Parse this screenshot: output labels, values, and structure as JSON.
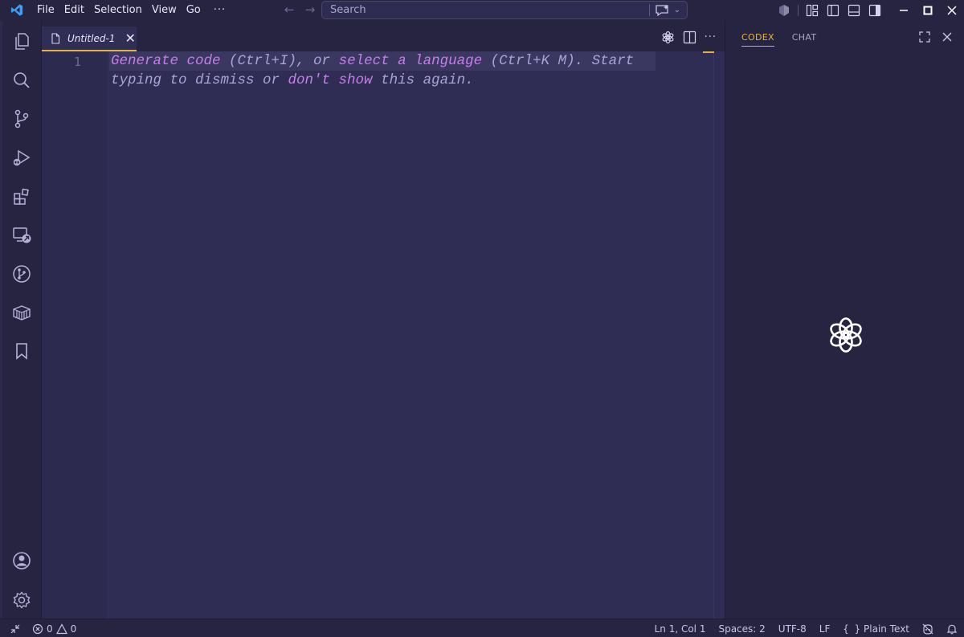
{
  "menu": {
    "items": [
      "File",
      "Edit",
      "Selection",
      "View",
      "Go"
    ],
    "more": "···"
  },
  "search": {
    "placeholder": "Search"
  },
  "tab": {
    "label": "Untitled-1",
    "close": "✕"
  },
  "editor": {
    "line_number": "1",
    "hint": {
      "part1": "Generate code",
      "part2": " (Ctrl+I), or ",
      "part3": "select a language",
      "part4": " (Ctrl+K M). Start",
      "part5": "typing to dismiss or ",
      "part6": "don't show",
      "part7": " this again."
    },
    "more": "···"
  },
  "panel": {
    "tabs": [
      "CODEX",
      "CHAT"
    ],
    "active_tab": "CODEX"
  },
  "status": {
    "errors": "0",
    "warnings": "0",
    "position": "Ln 1, Col 1",
    "spaces": "Spaces: 2",
    "encoding": "UTF-8",
    "eol": "LF",
    "language": "Plain Text"
  },
  "colors": {
    "background": "#262441",
    "editor": "#302d55",
    "accent": "#e3b341",
    "keyword": "#c77dea",
    "logo": "#3a9ff5"
  },
  "icons": [
    "vscode-logo",
    "explorer-icon",
    "search-icon",
    "source-control-icon",
    "run-debug-icon",
    "extensions-icon",
    "remote-explorer-icon",
    "git-graph-icon",
    "containers-icon",
    "bookmarks-icon",
    "account-icon",
    "settings-icon",
    "openai-icon",
    "split-editor-icon",
    "maximize-icon",
    "close-icon",
    "bell-icon"
  ]
}
